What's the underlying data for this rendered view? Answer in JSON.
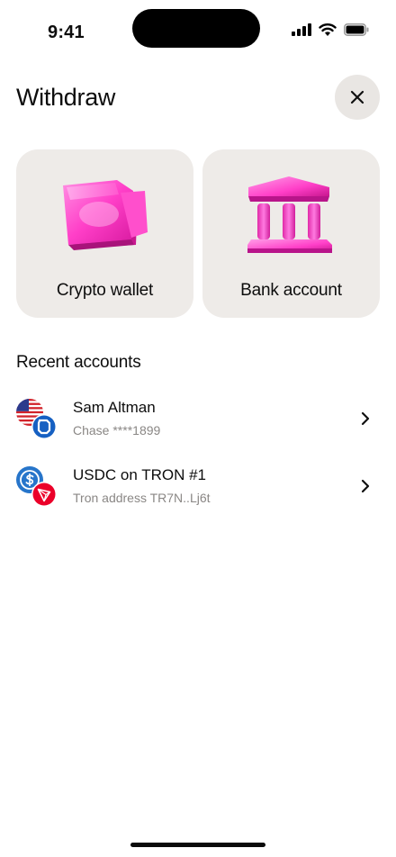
{
  "status_bar": {
    "time": "9:41",
    "icons": [
      "cellular-signal-icon",
      "wifi-icon",
      "battery-icon"
    ]
  },
  "header": {
    "title": "Withdraw",
    "close_icon": "close-icon"
  },
  "options": [
    {
      "label": "Crypto wallet",
      "icon": "wallet-icon"
    },
    {
      "label": "Bank account",
      "icon": "bank-icon"
    }
  ],
  "recent": {
    "title": "Recent accounts",
    "accounts": [
      {
        "name": "Sam Altman",
        "detail": "Chase ****1899",
        "icon": "us-flag-chase-icon"
      },
      {
        "name": "USDC on TRON #1",
        "detail": "Tron address TR7N..Lj6t",
        "icon": "usdc-tron-icon"
      }
    ]
  },
  "colors": {
    "accent": "#ff3fc8",
    "card_bg": "#eeebe8",
    "secondary_text": "#8a8785"
  }
}
